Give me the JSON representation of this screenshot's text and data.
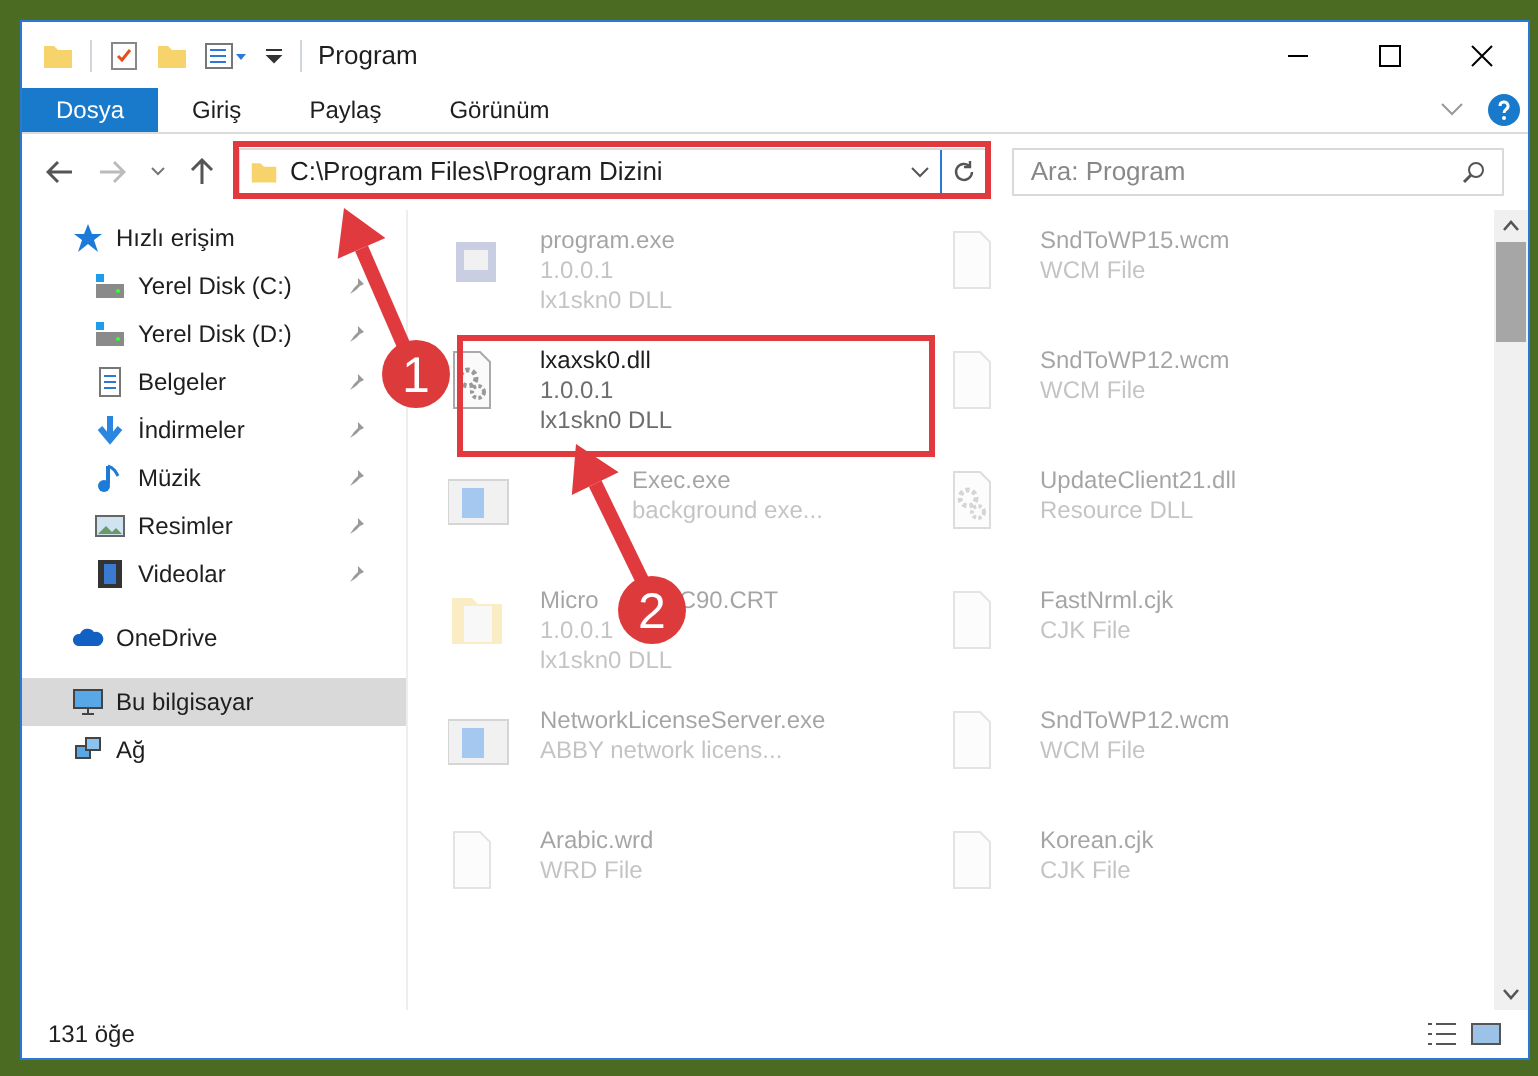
{
  "window": {
    "title": "Program"
  },
  "ribbon_tabs": [
    {
      "label": "Dosya",
      "selected": true
    },
    {
      "label": "Giriş",
      "selected": false
    },
    {
      "label": "Paylaş",
      "selected": false
    },
    {
      "label": "Görünüm",
      "selected": false
    }
  ],
  "address": {
    "path": "C:\\Program Files\\Program Dizini"
  },
  "search": {
    "placeholder": "Ara: Program"
  },
  "sidebar": {
    "items": [
      {
        "label": "Hızlı erişim",
        "selected": false,
        "children": [
          {
            "label": "Yerel Disk (C:)",
            "pinned": true,
            "selected": false
          },
          {
            "label": "Yerel Disk (D:)",
            "pinned": true,
            "selected": false
          },
          {
            "label": "Belgeler",
            "pinned": true,
            "selected": false
          },
          {
            "label": "İndirmeler",
            "pinned": true,
            "selected": false
          },
          {
            "label": "Müzik",
            "pinned": true,
            "selected": false
          },
          {
            "label": "Resimler",
            "pinned": true,
            "selected": false
          },
          {
            "label": "Videolar",
            "pinned": true,
            "selected": false
          }
        ]
      },
      {
        "label": "OneDrive",
        "selected": false
      },
      {
        "label": "Bu bilgisayar",
        "selected": true
      },
      {
        "label": "Ağ",
        "selected": false
      }
    ]
  },
  "files": [
    {
      "name": [
        "program.exe"
      ],
      "lines": [
        "1.0.0.1",
        "lx1skn0 DLL"
      ],
      "kind": "setup",
      "blurred": true
    },
    {
      "name": [
        "SndToWP15.wcm"
      ],
      "lines": [
        "WCM File"
      ],
      "kind": "blank",
      "blurred": true
    },
    {
      "name": [
        "lxaxsk0.dll"
      ],
      "lines": [
        "1.0.0.1",
        "lx1skn0 DLL"
      ],
      "kind": "dll",
      "blurred": false
    },
    {
      "name": [
        "SndToWP12.wcm"
      ],
      "lines": [
        "WCM File"
      ],
      "kind": "blank",
      "blurred": true
    },
    {
      "name": [
        "Exec.exe"
      ],
      "lines": [
        "background exe..."
      ],
      "kind": "app",
      "blurred": true
    },
    {
      "name": [
        "UpdateClient21.dll"
      ],
      "lines": [
        "Resource DLL"
      ],
      "kind": "dll",
      "blurred": true
    },
    {
      "name": [
        "Micro",
        "C90.CRT"
      ],
      "lines": [
        "1.0.0.1",
        "lx1skn0 DLL"
      ],
      "kind": "folder",
      "blurred": true
    },
    {
      "name": [
        "FastNrml.cjk"
      ],
      "lines": [
        "CJK File"
      ],
      "kind": "blank",
      "blurred": true
    },
    {
      "name": [
        "NetworkLicenseServer.exe"
      ],
      "lines": [
        "ABBY network licens..."
      ],
      "kind": "app",
      "blurred": true
    },
    {
      "name": [
        "SndToWP12.wcm"
      ],
      "lines": [
        "WCM File"
      ],
      "kind": "blank",
      "blurred": true
    },
    {
      "name": [
        "Arabic.wrd"
      ],
      "lines": [
        "WRD File"
      ],
      "kind": "blank",
      "blurred": true
    },
    {
      "name": [
        "Korean.cjk"
      ],
      "lines": [
        "CJK File"
      ],
      "kind": "blank",
      "blurred": true
    }
  ],
  "status_bar": {
    "count": "131 öğe"
  },
  "annotations": [
    {
      "label": "1"
    },
    {
      "label": "2"
    }
  ]
}
